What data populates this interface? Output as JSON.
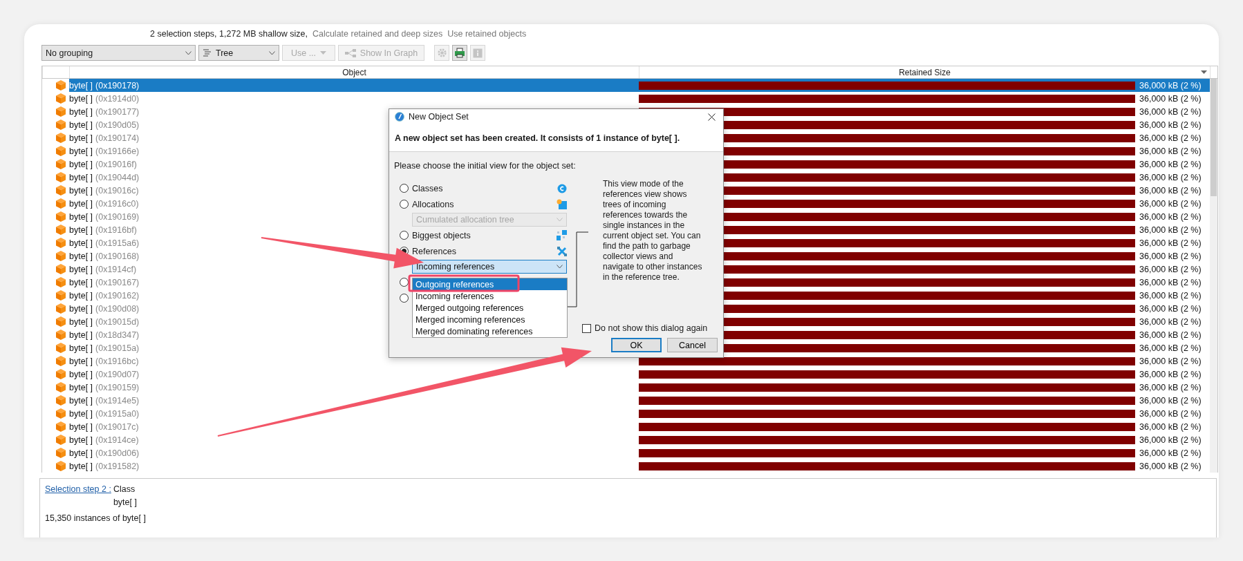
{
  "summary": {
    "text": "2 selection steps, 1,272 MB shallow size,",
    "links": [
      "Calculate retained and deep sizes",
      "Use retained objects"
    ]
  },
  "toolbar": {
    "grouping": "No grouping",
    "view": "Tree",
    "buttons": [
      {
        "label": "Use ...",
        "kind": "menu",
        "disabled": true
      },
      {
        "label": "Show In Graph",
        "kind": "graph",
        "disabled": true
      }
    ],
    "icon_buttons": [
      {
        "kind": "settings",
        "disabled": true
      },
      {
        "kind": "export",
        "disabled": false
      },
      {
        "kind": "info",
        "disabled": true
      }
    ]
  },
  "table": {
    "columns": [
      "Object",
      "Retained Size"
    ],
    "rows": [
      {
        "name": "byte[ ]",
        "address": "(0x190178)",
        "retained": "36,000 kB (2 %)",
        "selected": true
      },
      {
        "name": "byte[ ]",
        "address": "(0x1914d0)",
        "retained": "36,000 kB (2 %)",
        "selected": false
      },
      {
        "name": "byte[ ]",
        "address": "(0x190177)",
        "retained": "36,000 kB (2 %)",
        "selected": false
      },
      {
        "name": "byte[ ]",
        "address": "(0x190d05)",
        "retained": "36,000 kB (2 %)",
        "selected": false
      },
      {
        "name": "byte[ ]",
        "address": "(0x190174)",
        "retained": "36,000 kB (2 %)",
        "selected": false
      },
      {
        "name": "byte[ ]",
        "address": "(0x19166e)",
        "retained": "36,000 kB (2 %)",
        "selected": false
      },
      {
        "name": "byte[ ]",
        "address": "(0x19016f)",
        "retained": "36,000 kB (2 %)",
        "selected": false
      },
      {
        "name": "byte[ ]",
        "address": "(0x19044d)",
        "retained": "36,000 kB (2 %)",
        "selected": false
      },
      {
        "name": "byte[ ]",
        "address": "(0x19016c)",
        "retained": "36,000 kB (2 %)",
        "selected": false
      },
      {
        "name": "byte[ ]",
        "address": "(0x1916c0)",
        "retained": "36,000 kB (2 %)",
        "selected": false
      },
      {
        "name": "byte[ ]",
        "address": "(0x190169)",
        "retained": "36,000 kB (2 %)",
        "selected": false
      },
      {
        "name": "byte[ ]",
        "address": "(0x1916bf)",
        "retained": "36,000 kB (2 %)",
        "selected": false
      },
      {
        "name": "byte[ ]",
        "address": "(0x1915a6)",
        "retained": "36,000 kB (2 %)",
        "selected": false
      },
      {
        "name": "byte[ ]",
        "address": "(0x190168)",
        "retained": "36,000 kB (2 %)",
        "selected": false
      },
      {
        "name": "byte[ ]",
        "address": "(0x1914cf)",
        "retained": "36,000 kB (2 %)",
        "selected": false
      },
      {
        "name": "byte[ ]",
        "address": "(0x190167)",
        "retained": "36,000 kB (2 %)",
        "selected": false
      },
      {
        "name": "byte[ ]",
        "address": "(0x190162)",
        "retained": "36,000 kB (2 %)",
        "selected": false
      },
      {
        "name": "byte[ ]",
        "address": "(0x190d08)",
        "retained": "36,000 kB (2 %)",
        "selected": false
      },
      {
        "name": "byte[ ]",
        "address": "(0x19015d)",
        "retained": "36,000 kB (2 %)",
        "selected": false
      },
      {
        "name": "byte[ ]",
        "address": "(0x18d347)",
        "retained": "36,000 kB (2 %)",
        "selected": false
      },
      {
        "name": "byte[ ]",
        "address": "(0x19015a)",
        "retained": "36,000 kB (2 %)",
        "selected": false
      },
      {
        "name": "byte[ ]",
        "address": "(0x1916bc)",
        "retained": "36,000 kB (2 %)",
        "selected": false
      },
      {
        "name": "byte[ ]",
        "address": "(0x190d07)",
        "retained": "36,000 kB (2 %)",
        "selected": false
      },
      {
        "name": "byte[ ]",
        "address": "(0x190159)",
        "retained": "36,000 kB (2 %)",
        "selected": false
      },
      {
        "name": "byte[ ]",
        "address": "(0x1914e5)",
        "retained": "36,000 kB (2 %)",
        "selected": false
      },
      {
        "name": "byte[ ]",
        "address": "(0x1915a0)",
        "retained": "36,000 kB (2 %)",
        "selected": false
      },
      {
        "name": "byte[ ]",
        "address": "(0x19017c)",
        "retained": "36,000 kB (2 %)",
        "selected": false
      },
      {
        "name": "byte[ ]",
        "address": "(0x1914ce)",
        "retained": "36,000 kB (2 %)",
        "selected": false
      },
      {
        "name": "byte[ ]",
        "address": "(0x190d06)",
        "retained": "36,000 kB (2 %)",
        "selected": false
      },
      {
        "name": "byte[ ]",
        "address": "(0x191582)",
        "retained": "36,000 kB (2 %)",
        "selected": false
      }
    ]
  },
  "dialog": {
    "title": "New Object Set",
    "message": "A new object set has been created. It consists of 1 instance of byte[ ].",
    "prompt": "Please choose the initial view for the object set:",
    "options": [
      {
        "kind": "radio",
        "label": "Classes",
        "selected": false
      },
      {
        "kind": "radio",
        "label": "Allocations",
        "selected": false
      },
      {
        "kind": "combo",
        "value": "Cumulated allocation tree",
        "disabled": true
      },
      {
        "kind": "radio",
        "label": "Biggest objects",
        "selected": false
      },
      {
        "kind": "radio",
        "label": "References",
        "selected": true
      },
      {
        "kind": "combo",
        "value": "Incoming references",
        "disabled": false
      },
      {
        "kind": "radio",
        "selected": false
      },
      {
        "kind": "radio",
        "selected": false
      }
    ],
    "dropdown": [
      {
        "label": "Outgoing references",
        "selected": true
      },
      {
        "label": "Incoming references",
        "selected": false
      },
      {
        "label": "Merged outgoing references",
        "selected": false
      },
      {
        "label": "Merged incoming references",
        "selected": false
      },
      {
        "label": "Merged dominating references",
        "selected": false
      }
    ],
    "description": "This view mode of the references view shows trees of incoming references towards the single instances in the current object set. You can find the path to garbage collector views and navigate to other instances in the reference tree.",
    "checkbox": {
      "label": "Do not show this dialog again",
      "checked": false
    },
    "buttons": [
      {
        "label": "OK",
        "default": true
      },
      {
        "label": "Cancel",
        "default": false
      }
    ]
  },
  "details": {
    "link": "Selection step 2 :",
    "label": "Class",
    "value": "byte[ ]",
    "summary": "15,350 instances of byte[ ]"
  }
}
